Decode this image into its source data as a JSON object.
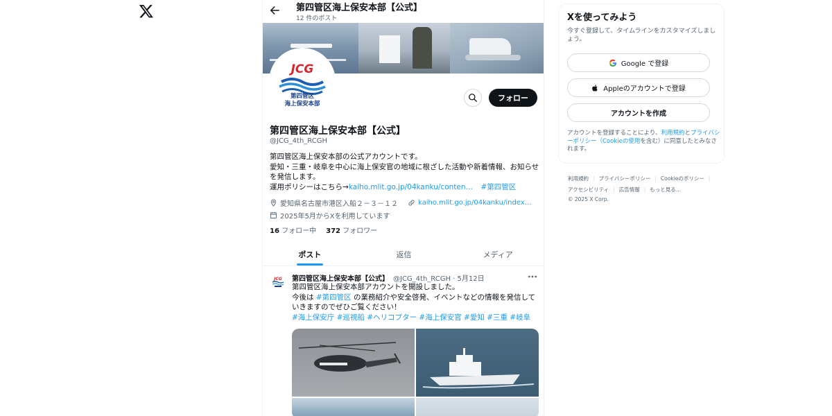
{
  "header": {
    "title": "第四管区海上保安本部【公式】",
    "post_count": "12 件のポスト"
  },
  "avatar": {
    "logo_text": "JCG",
    "line1": "第四管区",
    "line2": "海上保安本部"
  },
  "profile": {
    "name": "第四管区海上保安本部【公式】",
    "handle": "@JCG_4th_RCGH",
    "follow_label": "フォロー",
    "bio_line1": "第四管区海上保安本部の公式アカウントです。",
    "bio_line2": "愛知・三重・岐阜を中心に海上保安官の地域に根ざした活動や新着情報、お知らせを発信します。",
    "bio_line3_prefix": "運用ポリシーはこちら→",
    "bio_link": "kaiho.mlit.go.jp/04kanku/conten…",
    "bio_hashtag": "#第四管区",
    "location": "愛知県名古屋市港区入船２－３－１２",
    "website": "kaiho.mlit.go.jp/04kanku/index…",
    "joined": "2025年5月からXを利用しています",
    "following_count": "16",
    "following_label": "フォロー中",
    "followers_count": "372",
    "followers_label": "フォロワー"
  },
  "tabs": [
    "ポスト",
    "返信",
    "メディア"
  ],
  "post": {
    "name": "第四管区海上保安本部【公式】",
    "meta": "@JCG_4th_RCGH · 5月12日",
    "line1": "第四管区海上保安本部アカウントを開設しました。",
    "line2_prefix": "今後は ",
    "line2_hashtag": "#第四管区",
    "line2_suffix": " の業務紹介や安全啓発、イベントなどの情報を発信していきますのでぜひご覧ください！",
    "hashtags": "#海上保安庁 #巡視船 #ヘリコプター #海上保安官 #愛知 #三重 #岐阜"
  },
  "sidebar": {
    "title": "Xを使ってみよう",
    "desc": "今すぐ登録して、タイムラインをカスタマイズしましょう。",
    "google_label": "Google で登録",
    "apple_label": "Appleのアカウントで登録",
    "create_label": "アカウントを作成",
    "terms_prefix": "アカウントを登録することにより、",
    "terms_link1": "利用規約",
    "terms_mid1": "と",
    "terms_link2": "プライバシーポリシー（Cookieの使用",
    "terms_suffix": "を含む）に同意したとみなされます。"
  },
  "footer": {
    "links": [
      "利用規約",
      "プライバシーポリシー",
      "Cookieのポリシー",
      "アクセシビリティ",
      "広告情報",
      "もっと見る…"
    ],
    "copyright": "© 2025 X Corp."
  },
  "colors": {
    "accent": "#1d9bf0",
    "text": "#0f1419",
    "muted": "#536471",
    "border": "#eff3f4"
  }
}
